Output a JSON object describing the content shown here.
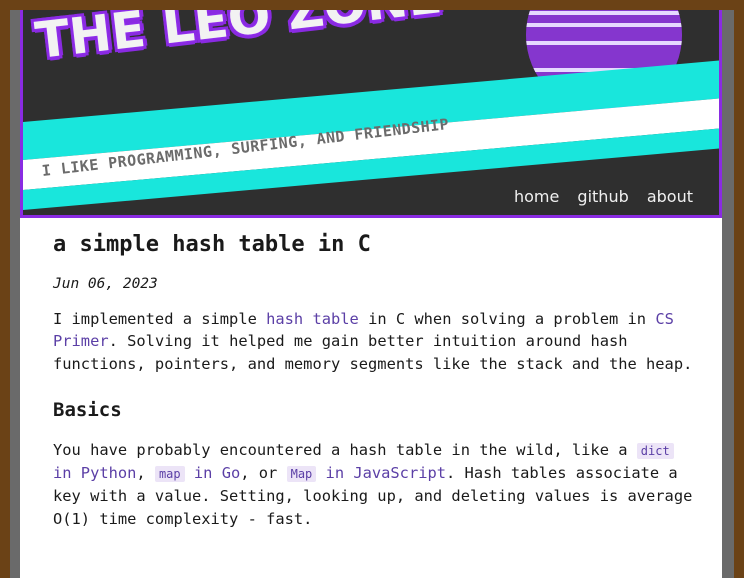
{
  "site": {
    "title": "THE LEO ZONE",
    "tagline": "I LIKE PROGRAMMING, SURFING, AND FRIENDSHIP"
  },
  "nav": {
    "items": [
      "home",
      "github",
      "about"
    ]
  },
  "colors": {
    "accent": "#8a2be2",
    "cyan": "#19e6dc",
    "banner_bg": "#2f2f2f",
    "link": "#5b3fa6",
    "border_brown": "#6b4216"
  },
  "post": {
    "title": "a simple hash table in C",
    "date": "Jun 06, 2023",
    "p1": {
      "t1": "I implemented a simple ",
      "l1": "hash table",
      "t2": " in C when solving a problem in ",
      "l2": "CS Primer",
      "t3": ". Solving it helped me gain better intuition around hash functions, pointers, and memory segments like the stack and the heap."
    },
    "h2": "Basics",
    "p2": {
      "t1": "You have probably encountered a hash table in the wild, like a ",
      "c1": "dict",
      "l1": " in Python",
      "t2": ", ",
      "c2": "map",
      "l2": " in Go",
      "t3": ", or ",
      "c3": "Map",
      "l3": " in JavaScript",
      "t4": ". Hash tables associate a key with a value. Setting, looking up, and deleting values is average O(1) time complexity - fast."
    }
  }
}
